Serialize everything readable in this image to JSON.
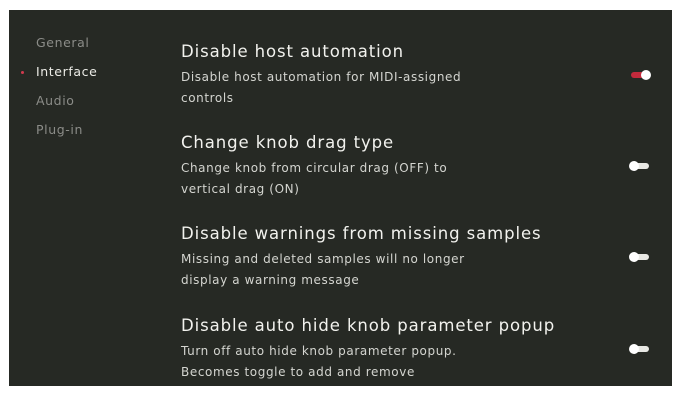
{
  "sidebar": {
    "items": [
      {
        "label": "General",
        "active": false
      },
      {
        "label": "Interface",
        "active": true
      },
      {
        "label": "Audio",
        "active": false
      },
      {
        "label": "Plug-in",
        "active": false
      }
    ]
  },
  "settings": [
    {
      "title": "Disable host automation",
      "description": "Disable host automation for MIDI-assigned controls",
      "enabled": true
    },
    {
      "title": "Change knob drag type",
      "description": "Change knob from circular drag (OFF) to vertical drag (ON)",
      "enabled": false
    },
    {
      "title": "Disable warnings from missing samples",
      "description": "Missing and deleted samples will no longer display a warning message",
      "enabled": false
    },
    {
      "title": "Disable auto hide knob parameter popup",
      "description": "Turn off auto hide knob parameter popup. Becomes toggle to add and remove",
      "enabled": false
    }
  ],
  "colors": {
    "panel_bg": "#262924",
    "accent": "#c22a3c",
    "text_primary": "#f2f2ee",
    "text_muted": "#8b8c88"
  }
}
